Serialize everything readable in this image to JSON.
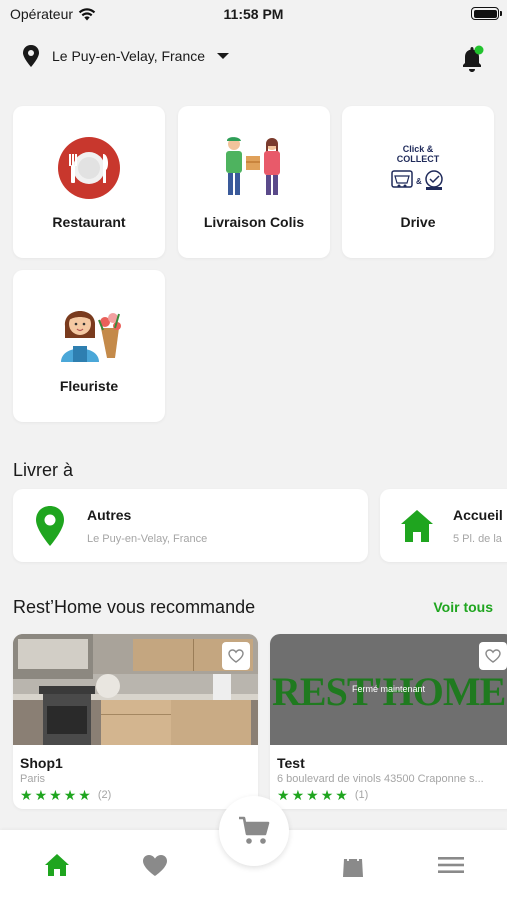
{
  "status_bar": {
    "carrier": "Opérateur",
    "time": "11:58 PM"
  },
  "header": {
    "location": "Le Puy-en-Velay, France"
  },
  "categories": [
    {
      "label": "Restaurant",
      "icon": "restaurant-plate-icon"
    },
    {
      "label": "Livraison Colis",
      "icon": "parcel-delivery-icon"
    },
    {
      "label": "Drive",
      "icon": "click-collect-icon",
      "icon_text_1": "Click &",
      "icon_text_2": "COLLECT"
    },
    {
      "label": "Fleuriste",
      "icon": "florist-icon"
    }
  ],
  "deliver_section": {
    "title": "Livrer à",
    "addresses": [
      {
        "title": "Autres",
        "subtitle": "Le Puy-en-Velay, France",
        "icon": "location-pin-icon"
      },
      {
        "title": "Accueil",
        "subtitle": "5 Pl. de la",
        "icon": "home-icon"
      }
    ]
  },
  "recommend_section": {
    "title": "Rest’Home vous recommande",
    "see_all": "Voir tous",
    "shops": [
      {
        "name": "Shop1",
        "subtitle": "Paris",
        "stars": 5,
        "reviews": "(2)"
      },
      {
        "name": "Test",
        "subtitle": "6 boulevard de vinols 43500 Craponne s...",
        "stars": 5,
        "reviews": "(1)",
        "logo_text": "REST'HOME",
        "closed_label": "Fermé maintenant"
      }
    ]
  },
  "bottom_nav": {
    "items": [
      "home-icon",
      "heart-icon",
      "cart-icon",
      "shopping-bag-icon",
      "menu-icon"
    ]
  },
  "colors": {
    "accent": "#1fa51f",
    "background": "#f2f2f2",
    "notification_dot": "#22c32e"
  }
}
